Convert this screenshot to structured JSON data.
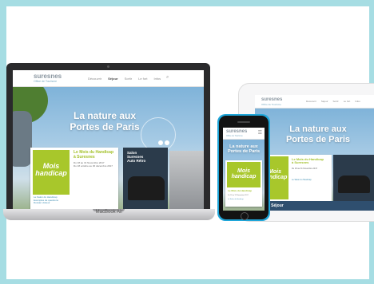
{
  "site": {
    "logo": "suresnes",
    "logo_tagline": "Office de Tourisme",
    "nav": [
      "Découvrir",
      "Séjour",
      "Sortir",
      "Le fort",
      "Infos"
    ],
    "hero_title_line1": "La nature aux",
    "hero_title_line2": "Portes de Paris",
    "badge_line1": "Mois",
    "badge_line2": "handicap",
    "event_title_line1": "Le Mois du Handicap",
    "event_title_line2": "à Suresnes",
    "event_date_line1": "Du 18 au 31 Novembre 2017",
    "event_date_line2": "Du 18 octobre au 30 décembre 2017",
    "link1": "Le Salon du Handicap",
    "link2": "Exemples de questions",
    "link3": "Dossier visiteur",
    "feature_line1": "Salon",
    "feature_line2": "Suresnes",
    "feature_line3": "Auto Rétro",
    "strip_label": "Idées Séjour"
  },
  "devices": {
    "laptop_brand": "MacBook Air"
  },
  "colors": {
    "frame": "#a6dde3",
    "accent_green": "#a8c72b",
    "phone_case": "#1fa6d9"
  }
}
